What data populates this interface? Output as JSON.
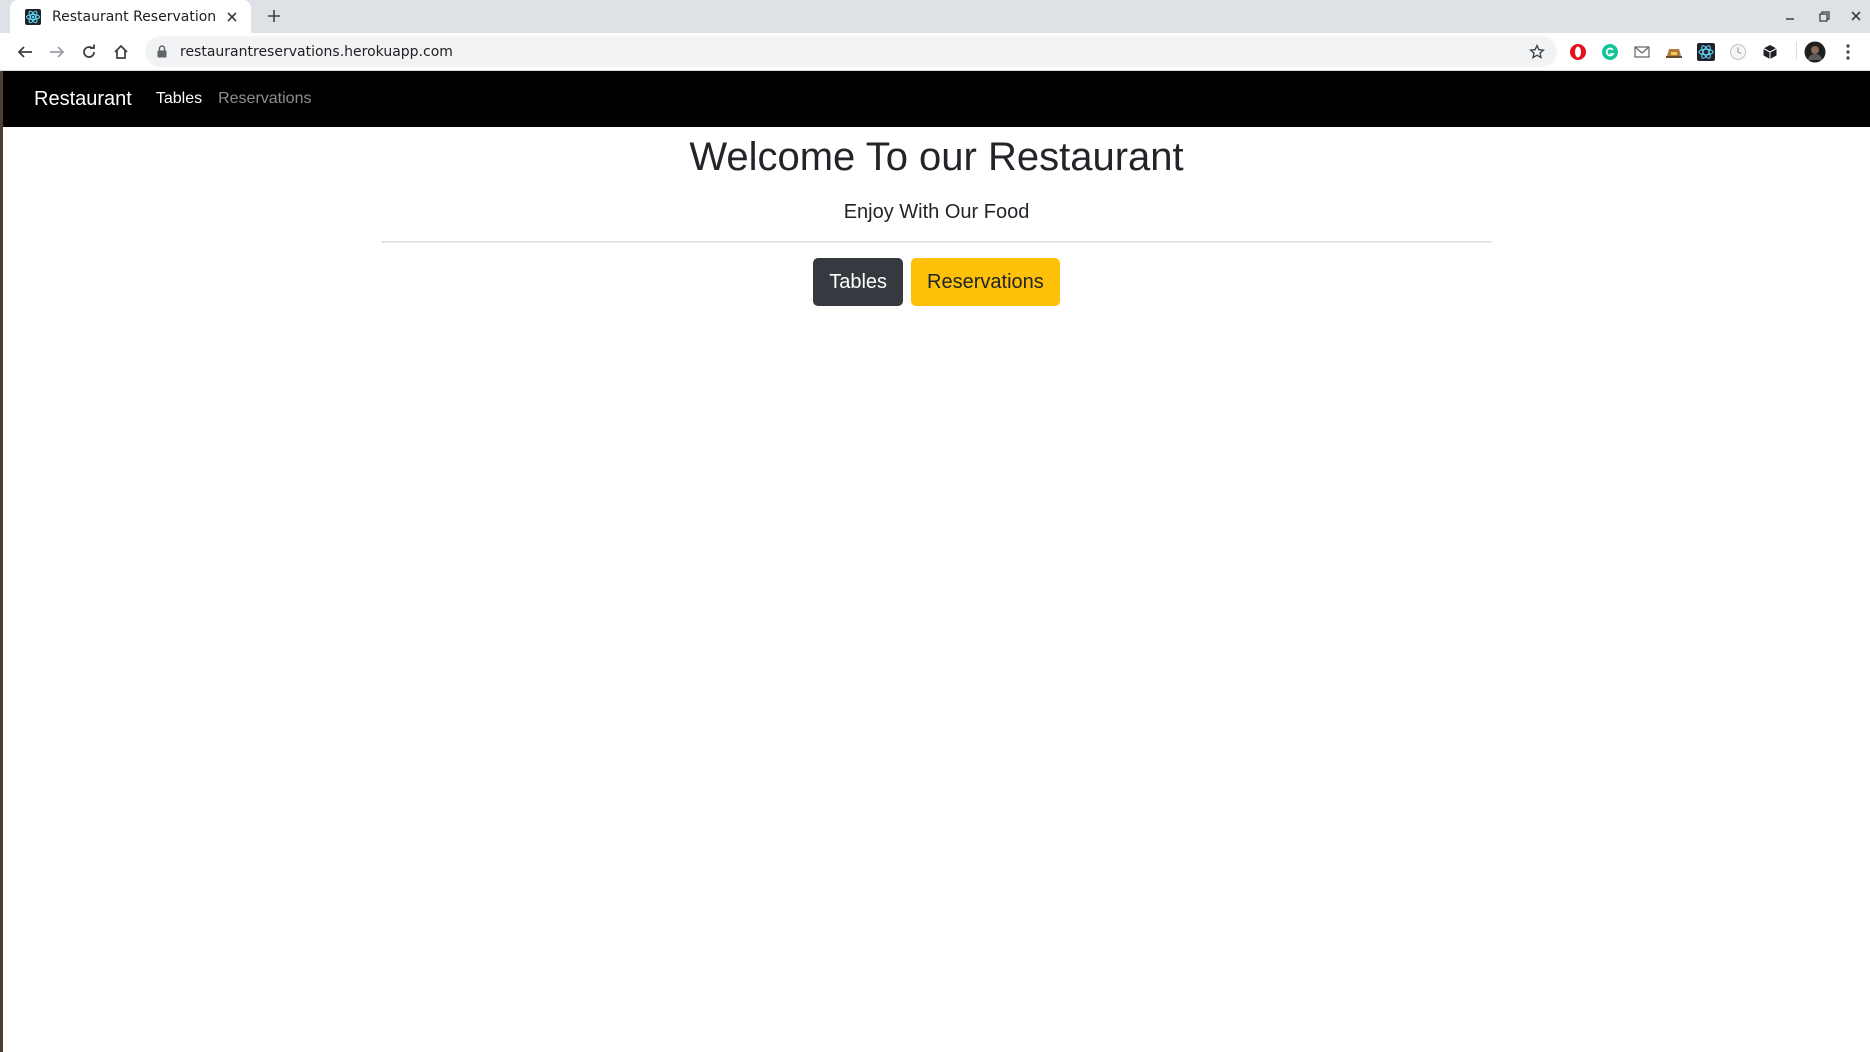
{
  "browser": {
    "tab_title": "Restaurant Reservation",
    "url": "restaurantreservations.herokuapp.com",
    "extensions": [
      "opera-icon",
      "grammarly-icon",
      "mail-icon",
      "hat-icon",
      "react-devtools-icon",
      "clock-icon",
      "cube-icon"
    ]
  },
  "navbar": {
    "brand": "Restaurant",
    "links": [
      {
        "label": "Tables",
        "state": "active"
      },
      {
        "label": "Reservations",
        "state": "inactive"
      }
    ]
  },
  "hero": {
    "title": "Welcome To our Restaurant",
    "subtitle": "Enjoy With Our Food",
    "buttons": [
      {
        "label": "Tables",
        "color": "#343a40"
      },
      {
        "label": "Reservations",
        "color": "#ffc107"
      }
    ]
  },
  "colors": {
    "navbar_bg": "#000000",
    "accent": "#ffc107",
    "dark": "#343a40"
  }
}
